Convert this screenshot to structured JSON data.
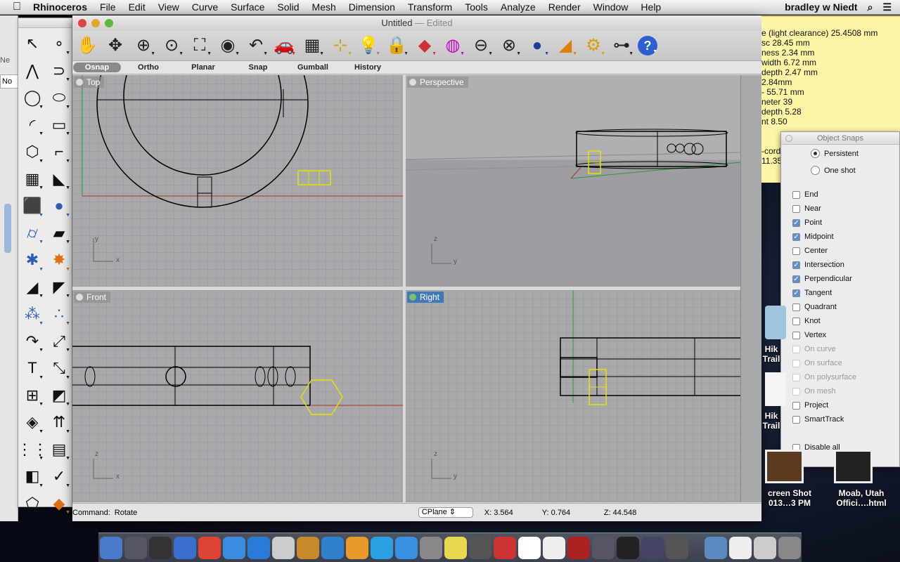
{
  "menubar": {
    "apple": "",
    "items": [
      "Rhinoceros",
      "File",
      "Edit",
      "View",
      "Curve",
      "Surface",
      "Solid",
      "Mesh",
      "Dimension",
      "Transform",
      "Tools",
      "Analyze",
      "Render",
      "Window",
      "Help"
    ],
    "user": "bradley w Niedt",
    "search_icon": "⌕",
    "list_icon": "☰"
  },
  "window": {
    "title": "Untitled",
    "edited": " — Edited"
  },
  "tabs": [
    "Osnap",
    "Ortho",
    "Planar",
    "Snap",
    "Gumball",
    "History"
  ],
  "viewports": {
    "top": "Top",
    "perspective": "Perspective",
    "front": "Front",
    "right": "Right"
  },
  "status": {
    "command_label": "Command:",
    "command_value": "Rotate",
    "cplane": "CPlane",
    "x": "X: 3.564",
    "y": "Y: 0.764",
    "z": "Z: 44.548"
  },
  "note_lines": [
    "e (light clearance) 25.4508 mm",
    "sc 28.45 mm",
    "ness 2.34 mm",
    "width 6.72 mm",
    "depth 2.47 mm",
    "2.84mm",
    "- 55.71 mm",
    "neter 39",
    "depth 5.28",
    "nt 8.50",
    "",
    "",
    "-cord",
    "11.35"
  ],
  "osnap": {
    "title": "Object Snaps",
    "modes": [
      {
        "label": "Persistent",
        "on": true
      },
      {
        "label": "One shot",
        "on": false
      }
    ],
    "items": [
      {
        "label": "End",
        "on": false
      },
      {
        "label": "Near",
        "on": false
      },
      {
        "label": "Point",
        "on": true
      },
      {
        "label": "Midpoint",
        "on": true
      },
      {
        "label": "Center",
        "on": false
      },
      {
        "label": "Intersection",
        "on": true
      },
      {
        "label": "Perpendicular",
        "on": true
      },
      {
        "label": "Tangent",
        "on": true
      },
      {
        "label": "Quadrant",
        "on": false
      },
      {
        "label": "Knot",
        "on": false
      },
      {
        "label": "Vertex",
        "on": false
      },
      {
        "label": "On curve",
        "on": false,
        "disabled": true
      },
      {
        "label": "On surface",
        "on": false,
        "disabled": true
      },
      {
        "label": "On polysurface",
        "on": false,
        "disabled": true
      },
      {
        "label": "On mesh",
        "on": false,
        "disabled": true
      },
      {
        "label": "Project",
        "on": false
      },
      {
        "label": "SmartTrack",
        "on": false
      }
    ],
    "disable_all": "Disable all"
  },
  "desktop": {
    "icons": [
      "Hik\nTrail",
      "Hik\nTrail",
      "creen Shot\n013…3 PM",
      "Moab, Utah\nOffici….html"
    ]
  },
  "left_window": {
    "fragments": [
      "Ne",
      "No"
    ]
  },
  "axes": {
    "x": "x",
    "y": "y",
    "z": "z"
  },
  "colors": {
    "accent": "#3f7ab7",
    "selection": "#e8e000",
    "x_axis": "#b03020",
    "y_axis": "#2a9a3a",
    "note": "#fdf6a6"
  }
}
